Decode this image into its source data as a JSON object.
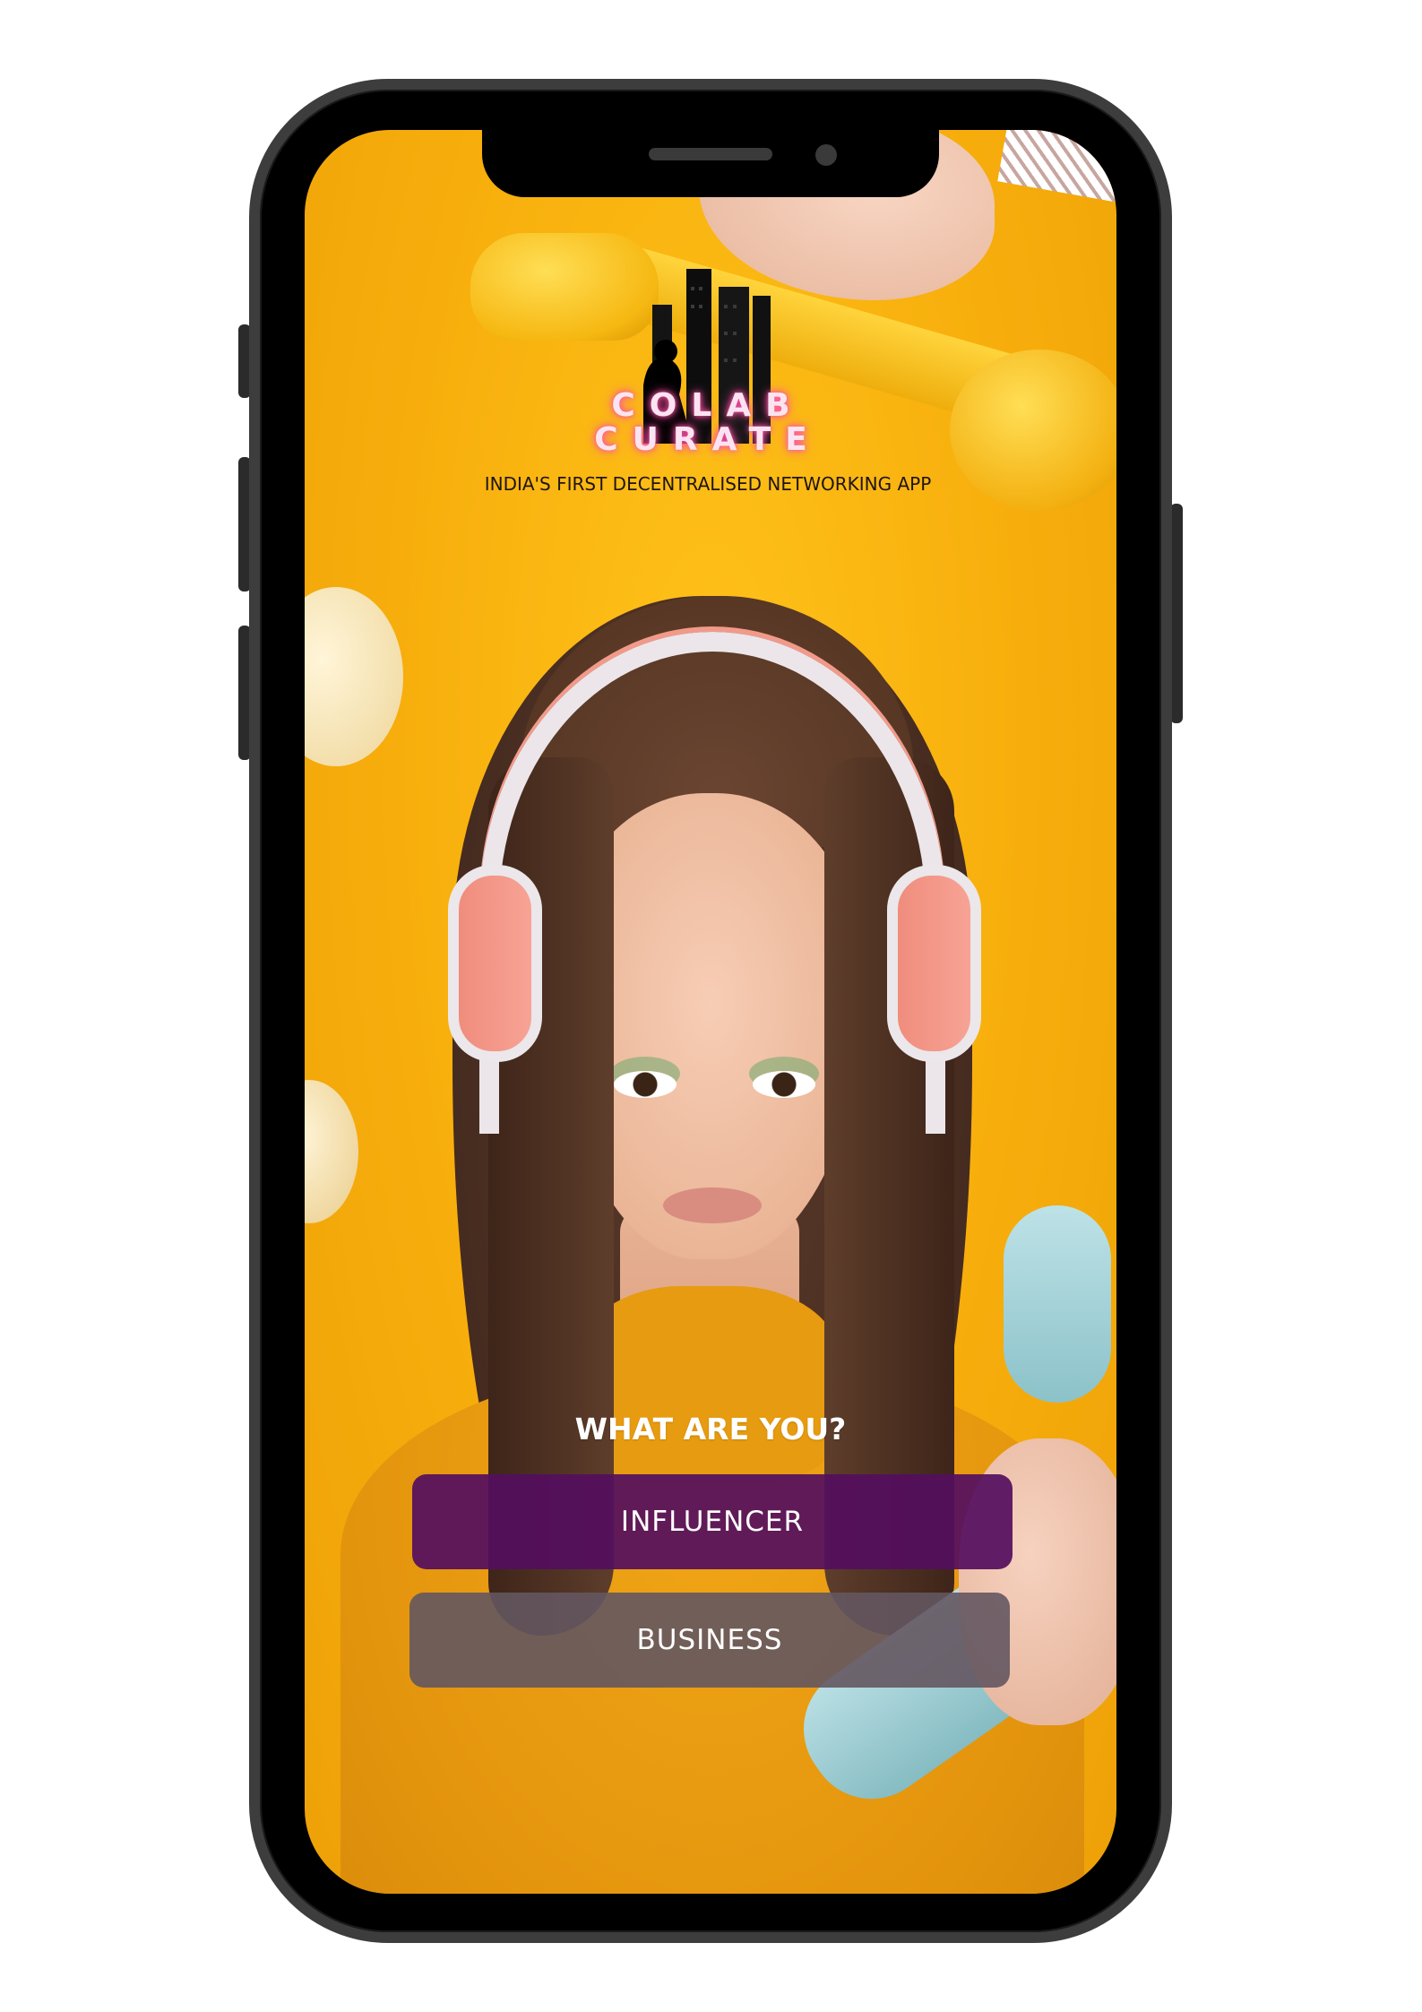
{
  "app": {
    "brand_line1": "COLAB",
    "brand_line2": "CURATE",
    "tagline": "INDIA'S FIRST DECENTRALISED NETWORKING APP"
  },
  "role_select": {
    "question": "WHAT ARE YOU?",
    "options": [
      {
        "label": "INFLUENCER"
      },
      {
        "label": "BUSINESS"
      }
    ]
  },
  "colors": {
    "background_yellow": "#f7ae0c",
    "influencer_button": "#540e5e",
    "business_button": "#645660",
    "brand_glow": "#ff4fa6"
  },
  "icons": {
    "logo": "city-skyline-silhouette-logo"
  }
}
